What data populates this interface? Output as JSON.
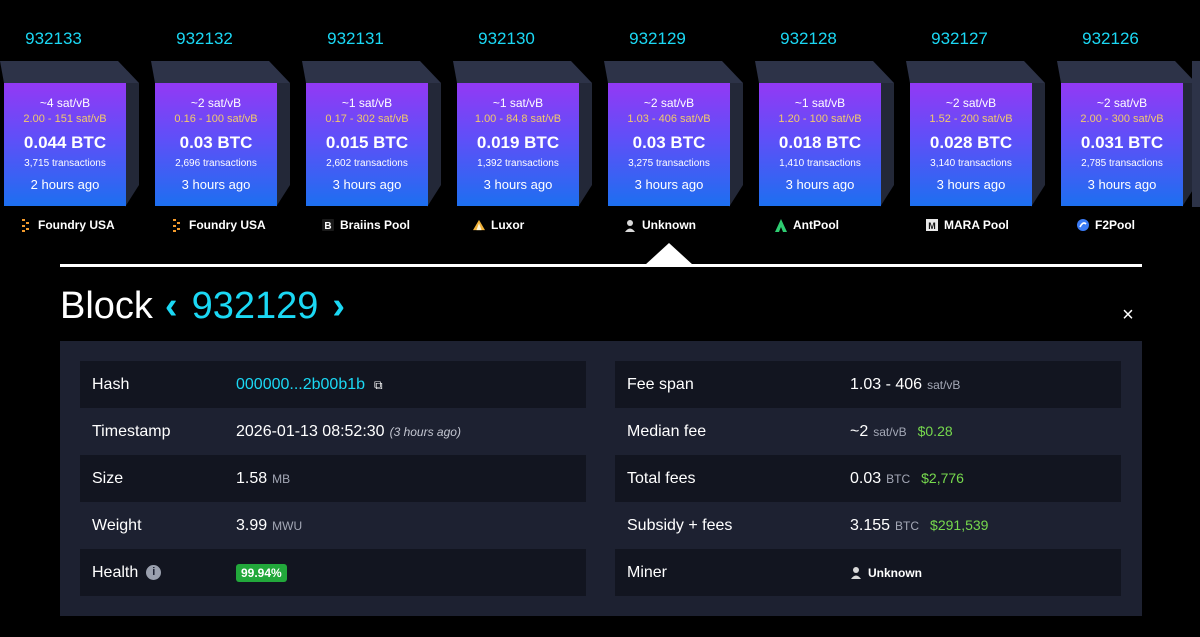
{
  "blocks": [
    {
      "height": "932133",
      "fee": "~4 sat/vB",
      "range": "2.00 - 151 sat/vB",
      "btc": "0.044 BTC",
      "tx": "3,715 transactions",
      "ago": "2 hours ago",
      "pool": "Foundry USA",
      "pool_icon": "foundry-icon"
    },
    {
      "height": "932132",
      "fee": "~2 sat/vB",
      "range": "0.16 - 100 sat/vB",
      "btc": "0.03 BTC",
      "tx": "2,696 transactions",
      "ago": "3 hours ago",
      "pool": "Foundry USA",
      "pool_icon": "foundry-icon"
    },
    {
      "height": "932131",
      "fee": "~1 sat/vB",
      "range": "0.17 - 302 sat/vB",
      "btc": "0.015 BTC",
      "tx": "2,602 transactions",
      "ago": "3 hours ago",
      "pool": "Braiins Pool",
      "pool_icon": "braiins-icon"
    },
    {
      "height": "932130",
      "fee": "~1 sat/vB",
      "range": "1.00 - 84.8 sat/vB",
      "btc": "0.019 BTC",
      "tx": "1,392 transactions",
      "ago": "3 hours ago",
      "pool": "Luxor",
      "pool_icon": "luxor-icon"
    },
    {
      "height": "932129",
      "fee": "~2 sat/vB",
      "range": "1.03 - 406 sat/vB",
      "btc": "0.03 BTC",
      "tx": "3,275 transactions",
      "ago": "3 hours ago",
      "pool": "Unknown",
      "pool_icon": "unknown-miner-icon"
    },
    {
      "height": "932128",
      "fee": "~1 sat/vB",
      "range": "1.20 - 100 sat/vB",
      "btc": "0.018 BTC",
      "tx": "1,410 transactions",
      "ago": "3 hours ago",
      "pool": "AntPool",
      "pool_icon": "antpool-icon"
    },
    {
      "height": "932127",
      "fee": "~2 sat/vB",
      "range": "1.52 - 200 sat/vB",
      "btc": "0.028 BTC",
      "tx": "3,140 transactions",
      "ago": "3 hours ago",
      "pool": "MARA Pool",
      "pool_icon": "mara-icon"
    },
    {
      "height": "932126",
      "fee": "~2 sat/vB",
      "range": "2.00 - 300 sat/vB",
      "btc": "0.031 BTC",
      "tx": "2,785 transactions",
      "ago": "3 hours ago",
      "pool": "F2Pool",
      "pool_icon": "f2pool-icon"
    }
  ],
  "header": {
    "word": "Block",
    "prev": "‹",
    "number": "932129",
    "next": "›",
    "close": "×"
  },
  "details": {
    "hash_label": "Hash",
    "hash_value": "000000...2b00b1b",
    "timestamp_label": "Timestamp",
    "timestamp_value": "2026-01-13 08:52:30",
    "timestamp_relative": "(3 hours ago)",
    "size_label": "Size",
    "size_value": "1.58",
    "size_unit": "MB",
    "weight_label": "Weight",
    "weight_value": "3.99",
    "weight_unit": "MWU",
    "health_label": "Health",
    "health_value": "99.94%",
    "fee_span_label": "Fee span",
    "fee_span_value": "1.03 - 406",
    "fee_span_unit": "sat/vB",
    "median_fee_label": "Median fee",
    "median_fee_value": "~2",
    "median_fee_unit": "sat/vB",
    "median_fee_usd": "$0.28",
    "total_fees_label": "Total fees",
    "total_fees_value": "0.03",
    "total_fees_unit": "BTC",
    "total_fees_usd": "$2,776",
    "subsidy_label": "Subsidy + fees",
    "subsidy_value": "3.155",
    "subsidy_unit": "BTC",
    "subsidy_usd": "$291,539",
    "miner_label": "Miner",
    "miner_value": "Unknown"
  },
  "colors": {
    "accent": "#1bd8f4",
    "fee_range": "#f3c96b",
    "usd": "#76d94d",
    "health": "#22a83b",
    "panel": "#1d2131"
  }
}
